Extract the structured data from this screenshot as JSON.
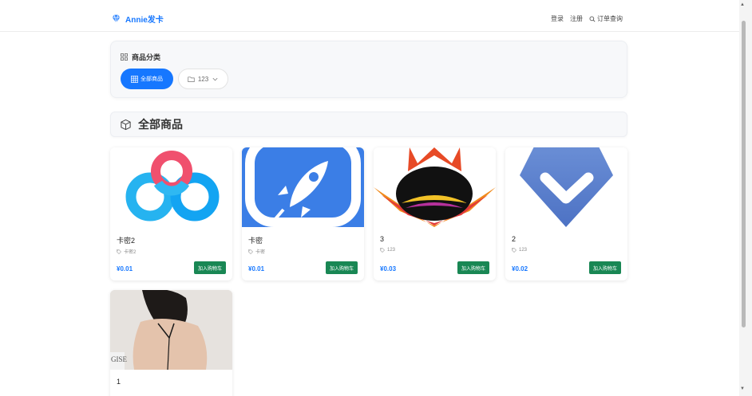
{
  "brand": {
    "name": "Annie发卡",
    "icon": "diamond-icon",
    "color": "#1677ff"
  },
  "nav": {
    "login": "登录",
    "register": "注册",
    "order_query": "订单查询"
  },
  "category_panel": {
    "title": "商品分类",
    "buttons": [
      {
        "label": "全部商品",
        "active": true
      },
      {
        "label": "123",
        "active": false
      }
    ]
  },
  "section": {
    "title": "全部商品"
  },
  "currency": "¥",
  "cart_label": "加入购物车",
  "products": [
    {
      "name": "卡密2",
      "tag": "卡密2",
      "price": "¥0.01",
      "image": "cloud-logo"
    },
    {
      "name": "卡密",
      "tag": "卡密",
      "price": "¥0.01",
      "image": "rocket-logo"
    },
    {
      "name": "3",
      "tag": "123",
      "price": "¥0.03",
      "image": "crown-mask-logo"
    },
    {
      "name": "2",
      "tag": "123",
      "price": "¥0.02",
      "image": "chevron-badge-logo"
    },
    {
      "name": "1",
      "image": "photo",
      "image_text": "GISE"
    }
  ],
  "colors": {
    "primary": "#1677ff",
    "cart_button": "#198754"
  }
}
